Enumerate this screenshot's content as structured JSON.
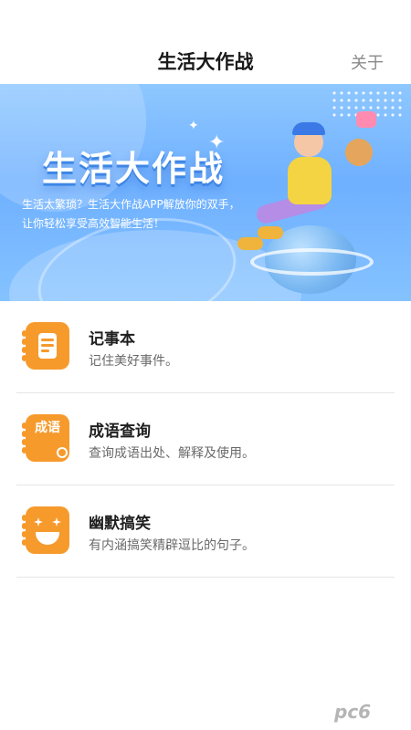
{
  "header": {
    "title": "生活大作战",
    "about_label": "关于"
  },
  "banner": {
    "title": "生活大作战",
    "description": "生活太繁琐？生活大作战APP解放你的双手，让你轻松享受高效智能生活！"
  },
  "list": {
    "items": [
      {
        "label": "记事本",
        "subtitle": "记住美好事件。",
        "icon": "notepad-icon"
      },
      {
        "label": "成语查询",
        "subtitle": "查询成语出处、解释及使用。",
        "icon": "idiom-search-icon",
        "icon_text": "成语"
      },
      {
        "label": "幽默搞笑",
        "subtitle": "有内涵搞笑精辟逗比的句子。",
        "icon": "laughing-face-icon"
      }
    ]
  },
  "watermark": {
    "text": "pc6"
  },
  "colors": {
    "accent": "#f69a2c",
    "banner_blue": "#6fb0ff"
  }
}
